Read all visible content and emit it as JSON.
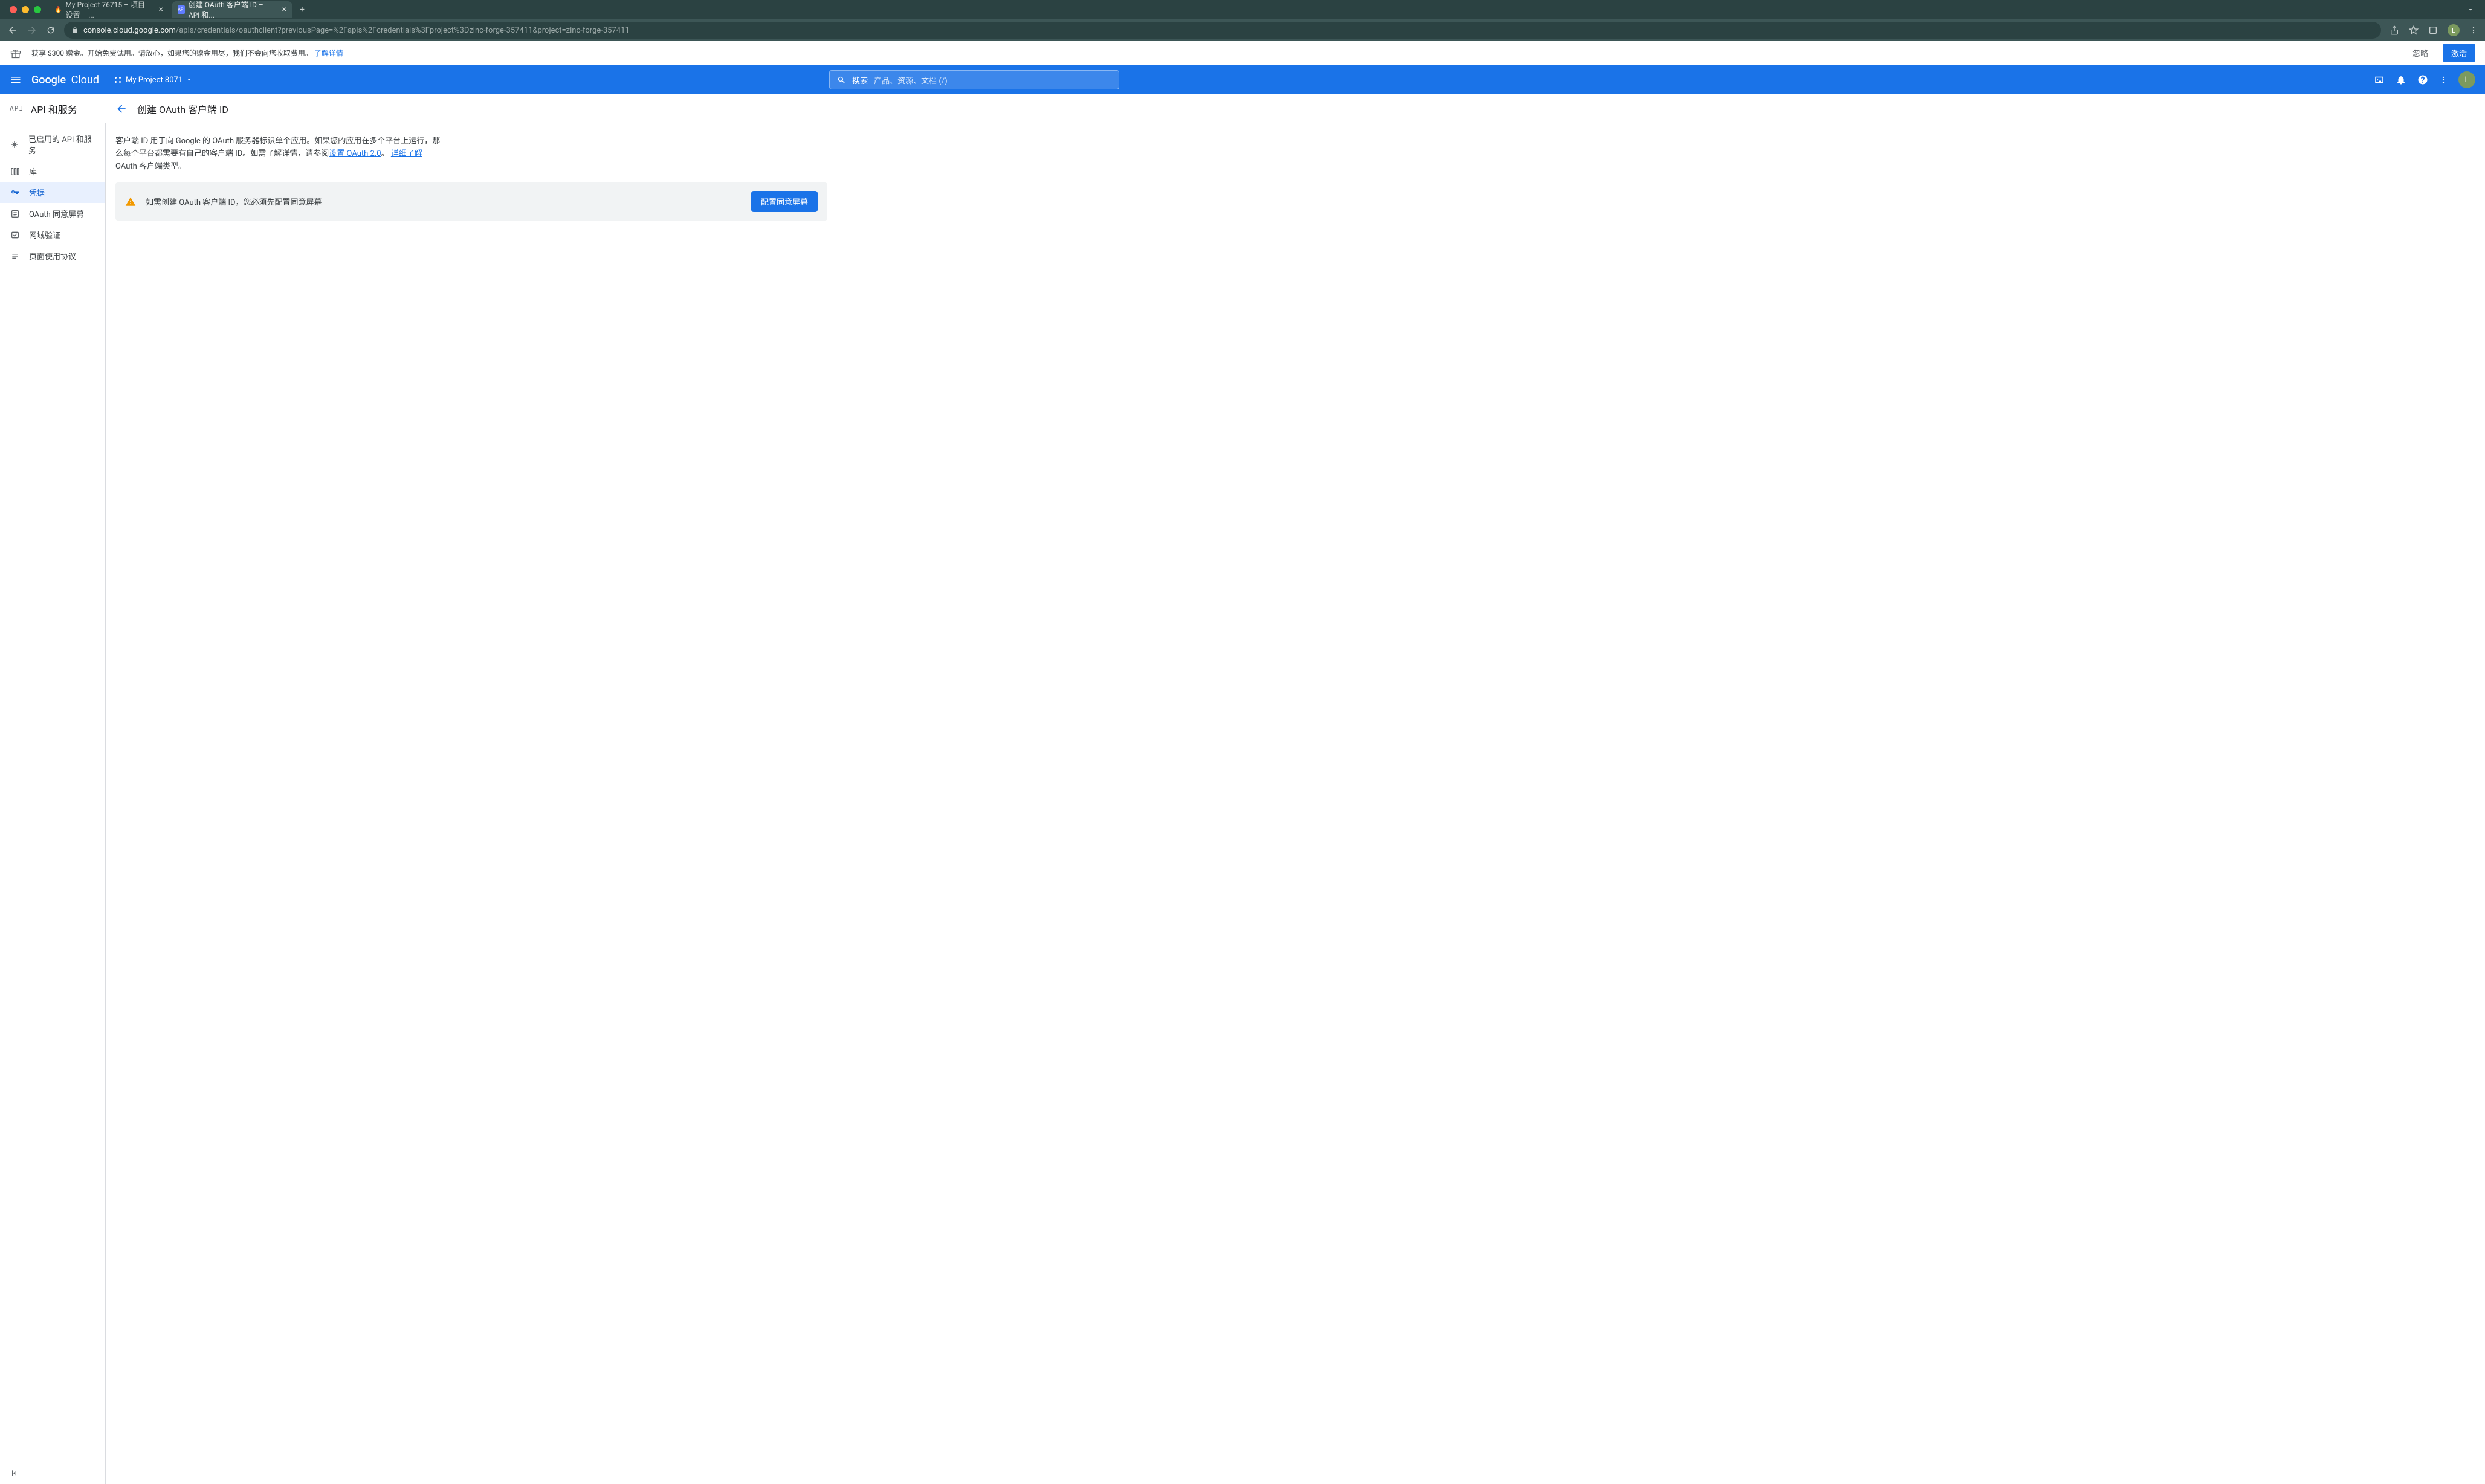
{
  "browser": {
    "tabs": [
      {
        "title": "My Project 76715 – 项目设置 – ...",
        "icon": "🔥"
      },
      {
        "title": "创建 OAuth 客户端 ID – API 和...",
        "icon": "API"
      }
    ],
    "url_domain": "console.cloud.google.com",
    "url_path": "/apis/credentials/oauthclient?previousPage=%2Fapis%2Fcredentials%3Fproject%3Dzinc-forge-357411&project=zinc-forge-357411",
    "avatar_letter": "L"
  },
  "promo": {
    "text": "获享 $300 赠金。开始免费试用。请放心，如果您的赠金用尽，我们不会向您收取费用。 ",
    "link": "了解详情",
    "skip": "忽略",
    "activate": "激活"
  },
  "header": {
    "logo1": "Google",
    "logo2": "Cloud",
    "project": "My Project 8071",
    "search_label": "搜索",
    "search_placeholder": "产品、资源、文档 (/)",
    "avatar_letter": "L"
  },
  "subheader": {
    "badge": "API",
    "section": "API 和服务",
    "page_title": "创建 OAuth 客户端 ID"
  },
  "sidebar": {
    "items": [
      {
        "label": "已启用的 API 和服务"
      },
      {
        "label": "库"
      },
      {
        "label": "凭据"
      },
      {
        "label": "OAuth 同意屏幕"
      },
      {
        "label": "网域验证"
      },
      {
        "label": "页面使用协议"
      }
    ]
  },
  "content": {
    "desc_part1": "客户端 ID 用于向 Google 的 OAuth 服务器标识单个应用。如果您的应用在多个平台上运行，那么每个平台都需要有自己的客户端 ID。如需了解详情，请参阅",
    "desc_link1": "设置 OAuth 2.0",
    "desc_part2": "。 ",
    "desc_link2": "详细了解",
    "desc_part3": " OAuth 客户端类型。",
    "alert_text": "如需创建 OAuth 客户端 ID，您必须先配置同意屏幕",
    "alert_button": "配置同意屏幕"
  }
}
